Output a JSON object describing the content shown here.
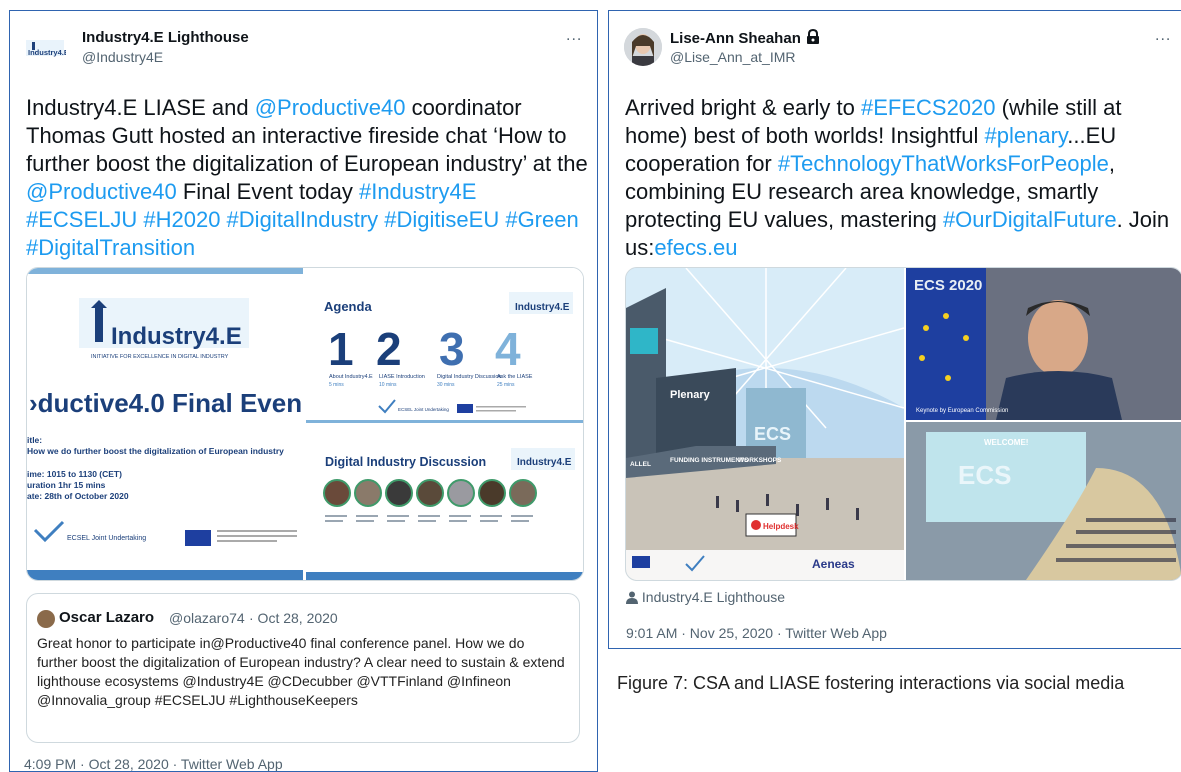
{
  "left_tweet": {
    "name": "Industry4.E Lighthouse",
    "handle": "@Industry4E",
    "more": "...",
    "logo_text": "Industry4.E",
    "text_parts": [
      {
        "t": "Industry4.E LIASE and ",
        "link": false
      },
      {
        "t": "@Productive40",
        "link": true
      },
      {
        "t": " coordinator Thomas Gutt hosted an interactive fireside chat ‘How to further boost the digitalization of European industry’ at the ",
        "link": false
      },
      {
        "t": "@Productive40",
        "link": true
      },
      {
        "t": " Final Event today ",
        "link": false
      },
      {
        "t": "#Industry4E #ECSELJU #H2020 #DigitalIndustry #DigitiseEU #Green #DigitalTransition",
        "link": true
      }
    ],
    "slide_main": {
      "logo": "Industry4.E",
      "tagline": "INITIATIVE FOR EXCELLENCE IN DIGITAL INDUSTRY",
      "title": "›ductive4.0 Final Even",
      "lines": [
        "itle:",
        "How we do further boost the digitalization of European industry",
        "ime: 1015 to 1130 (CET)",
        "uration 1hr 15 mins",
        "ate: 28th of October 2020"
      ],
      "footer": "ECSEL Joint Undertaking"
    },
    "slide_agenda": {
      "title": "Agenda",
      "logo": "Industry4.E",
      "items": [
        {
          "num": "1",
          "label": "About Industry4.E",
          "time": "5 mins"
        },
        {
          "num": "2",
          "label": "LIASE Introduction",
          "time": "10 mins"
        },
        {
          "num": "3",
          "label": "Digital Industry Discussion",
          "time": "30 mins"
        },
        {
          "num": "4",
          "label": "Ask the LIASE",
          "time": "25 mins"
        }
      ],
      "footer": "ECSEL Joint Undertaking"
    },
    "slide_discussion": {
      "title": "Digital Industry Discussion",
      "logo": "Industry4.E"
    },
    "quote": {
      "name": "Oscar Lazaro",
      "handle": "@olazaro74",
      "date": "· Oct 28, 2020",
      "text": "Great honor to participate in@Productive40 final conference panel. How we do further boost the digitalization of European industry? A clear need to sustain & extend lighthouse ecosystems @Industry4E @CDecubber @VTTFinland @Infineon @Innovalia_group #ECSELJU #LighthouseKeepers"
    },
    "timestamp": "4:09 PM · Oct 28, 2020 · Twitter Web App"
  },
  "right_tweet": {
    "name": "Lise-Ann Sheahan",
    "handle": "@Lise_Ann_at_IMR",
    "more": "...",
    "text_parts": [
      {
        "t": "Arrived bright & early to ",
        "link": false
      },
      {
        "t": "#EFECS2020",
        "link": true
      },
      {
        "t": " (while still at home) best of both worlds! Insightful ",
        "link": false
      },
      {
        "t": "#plenary",
        "link": true
      },
      {
        "t": "...EU cooperation for ",
        "link": false
      },
      {
        "t": "#TechnologyThatWorksForPeople",
        "link": true
      },
      {
        "t": ", combining EU research area knowledge, smartly protecting EU values, mastering ",
        "link": false
      },
      {
        "t": "#OurDigitalFuture",
        "link": true
      },
      {
        "t": ". Join us:",
        "link": false
      },
      {
        "t": "efecs.eu",
        "link": true
      }
    ],
    "image_labels": {
      "plenary": "Plenary",
      "ecs_sign": "ECS",
      "funding": "FUNDING INSTRUMENTS",
      "workshops": "WORKSHOPS",
      "allel": "ALLEL",
      "helpdesk": "Helpdesk",
      "aeneas": "Aeneas",
      "ecs2020": "ECS 2020",
      "keynote": "Keynote by European Commission",
      "welcome": "WELCOME!"
    },
    "tagged": "Industry4.E Lighthouse",
    "timestamp": "9:01 AM · Nov 25, 2020 · Twitter Web App"
  },
  "caption": "Figure 7: CSA and LIASE fostering interactions via social media",
  "colors": {
    "link": "#1d9bf0",
    "border": "#2f64b0",
    "slide_blue": "#1b3f7a"
  }
}
